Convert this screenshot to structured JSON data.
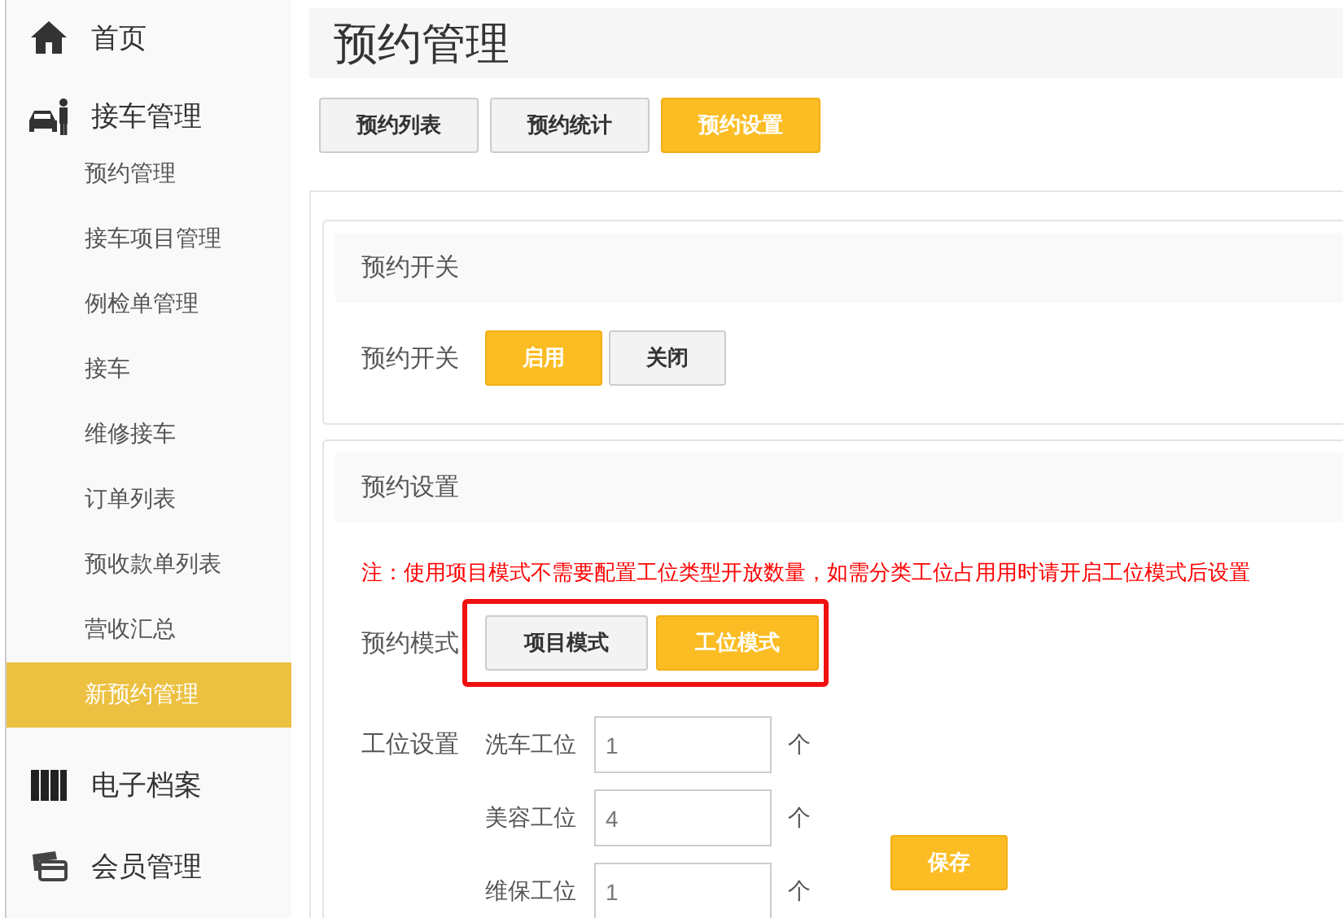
{
  "sidebar": [
    {
      "label": "首页"
    },
    {
      "label": "接车管理",
      "children": [
        {
          "label": "预约管理",
          "selected": false
        },
        {
          "label": "接车项目管理",
          "selected": false
        },
        {
          "label": "例检单管理",
          "selected": false
        },
        {
          "label": "接车",
          "selected": false
        },
        {
          "label": "维修接车",
          "selected": false
        },
        {
          "label": "订单列表",
          "selected": false
        },
        {
          "label": "预收款单列表",
          "selected": false
        },
        {
          "label": "营收汇总",
          "selected": false
        },
        {
          "label": "新预约管理",
          "selected": true
        }
      ]
    },
    {
      "label": "电子档案"
    },
    {
      "label": "会员管理"
    }
  ],
  "page_title": "预约管理",
  "tabs": [
    {
      "label": "预约列表",
      "selected": false
    },
    {
      "label": "预约统计",
      "selected": false
    },
    {
      "label": "预约设置",
      "selected": true
    }
  ],
  "switch_section": {
    "title": "预约开关",
    "label": "预约开关",
    "options": [
      {
        "label": "启用",
        "selected": true
      },
      {
        "label": "关闭",
        "selected": false
      }
    ]
  },
  "settings_section": {
    "title": "预约设置",
    "note": "注：使用项目模式不需要配置工位类型开放数量，如需分类工位占用用时请开启工位模式后设置",
    "mode_label": "预约模式",
    "highlighted": true,
    "modes": [
      {
        "label": "项目模式",
        "selected": false
      },
      {
        "label": "工位模式",
        "selected": true
      }
    ],
    "stations_label": "工位设置",
    "stations": [
      {
        "label": "洗车工位",
        "value": "1",
        "unit": "个"
      },
      {
        "label": "美容工位",
        "value": "4",
        "unit": "个"
      },
      {
        "label": "维保工位",
        "value": "1",
        "unit": "个"
      }
    ],
    "save_button": "保存"
  }
}
